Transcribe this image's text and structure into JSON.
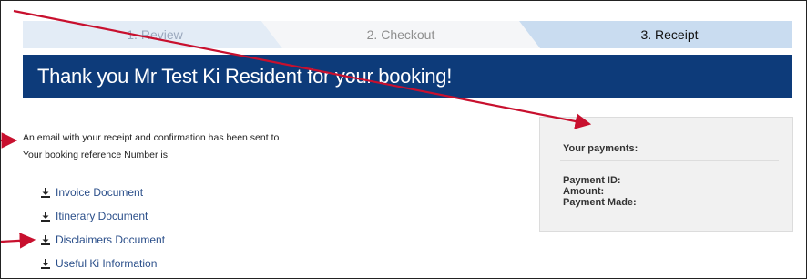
{
  "steps": [
    {
      "label": "1. Review",
      "state": "done"
    },
    {
      "label": "2. Checkout",
      "state": "inactive"
    },
    {
      "label": "3. Receipt",
      "state": "active"
    }
  ],
  "banner": {
    "title": "Thank you Mr Test Ki Resident for your booking!"
  },
  "confirmation": {
    "email_text": "An email with your receipt and confirmation has been sent to",
    "reference_text": "Your booking reference Number is"
  },
  "documents": [
    {
      "label": "Invoice Document",
      "icon": "download-icon"
    },
    {
      "label": "Itinerary Document",
      "icon": "download-icon"
    },
    {
      "label": "Disclaimers Document",
      "icon": "download-icon"
    },
    {
      "label": "Useful Ki Information",
      "icon": "download-icon"
    }
  ],
  "payments": {
    "heading": "Your payments:",
    "payment_id_label": "Payment ID:",
    "amount_label": "Amount:",
    "payment_made_label": "Payment Made:"
  },
  "colors": {
    "banner": "#0d3b7a",
    "annotation_arrow": "#c8102e",
    "link": "#2b4f8a"
  }
}
